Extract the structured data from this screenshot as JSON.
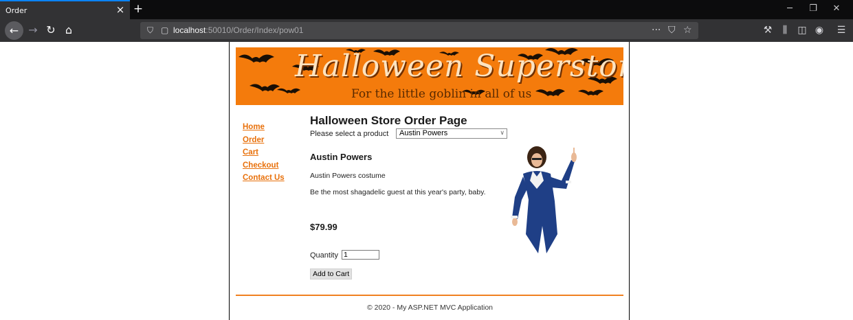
{
  "browser": {
    "tab_title": "Order",
    "tab_close": "×",
    "new_tab": "+",
    "url_host": "localhost",
    "url_path": ":50010/Order/Index/pow01",
    "window_controls": [
      "minimize-icon",
      "restore-icon",
      "close-icon"
    ],
    "toolbar_icons": [
      "wrench-icon",
      "library-icon",
      "sidebar-icon",
      "account-icon",
      "menu-icon"
    ],
    "accent": "#0a84ff"
  },
  "banner": {
    "title": "Halloween Superstore",
    "subtitle": "For the little goblin in all of us",
    "bg_color": "#f47b0c"
  },
  "nav": {
    "items": [
      {
        "label": "Home"
      },
      {
        "label": "Order"
      },
      {
        "label": "Cart"
      },
      {
        "label": "Checkout"
      },
      {
        "label": "Contact Us"
      }
    ],
    "link_color": "#e8700a"
  },
  "order": {
    "heading": "Halloween Store Order Page",
    "select_label": "Please select a product",
    "selected_product": "Austin Powers",
    "product_name": "Austin Powers",
    "short_description": "Austin Powers costume",
    "long_description": "Be the most shagadelic guest at this year's party, baby.",
    "price": "$79.99",
    "quantity_label": "Quantity",
    "quantity_value": "1",
    "add_button": "Add to Cart"
  },
  "footer": {
    "text": "© 2020 - My ASP.NET MVC Application"
  }
}
